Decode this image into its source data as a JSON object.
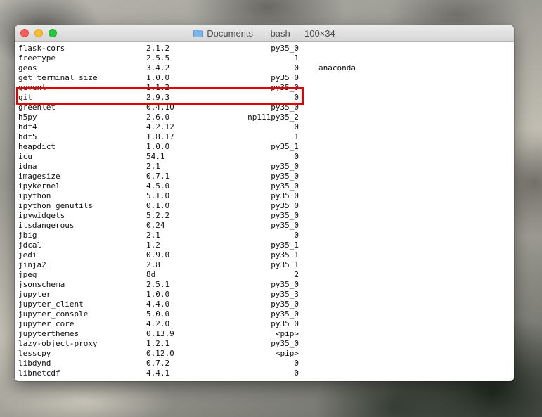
{
  "window": {
    "title": "Documents — -bash — 100×34",
    "folder_icon": "folder-icon",
    "colors": {
      "close": "#fc5f57",
      "minimize": "#fdbc2e",
      "maximize": "#28c840",
      "highlight": "#e50000"
    }
  },
  "terminal": {
    "rows": [
      {
        "name": "flask-cors",
        "version": "2.1.2",
        "build": "py35_0",
        "channel": ""
      },
      {
        "name": "freetype",
        "version": "2.5.5",
        "build": "1",
        "channel": ""
      },
      {
        "name": "geos",
        "version": "3.4.2",
        "build": "0",
        "channel": "anaconda"
      },
      {
        "name": "get_terminal_size",
        "version": "1.0.0",
        "build": "py35_0",
        "channel": ""
      },
      {
        "name": "gevent",
        "version": "1.1.2",
        "build": "py35_0",
        "channel": ""
      },
      {
        "name": "git",
        "version": "2.9.3",
        "build": "0",
        "channel": ""
      },
      {
        "name": "greenlet",
        "version": "0.4.10",
        "build": "py35_0",
        "channel": ""
      },
      {
        "name": "h5py",
        "version": "2.6.0",
        "build": "np111py35_2",
        "channel": ""
      },
      {
        "name": "hdf4",
        "version": "4.2.12",
        "build": "0",
        "channel": ""
      },
      {
        "name": "hdf5",
        "version": "1.8.17",
        "build": "1",
        "channel": ""
      },
      {
        "name": "heapdict",
        "version": "1.0.0",
        "build": "py35_1",
        "channel": ""
      },
      {
        "name": "icu",
        "version": "54.1",
        "build": "0",
        "channel": ""
      },
      {
        "name": "idna",
        "version": "2.1",
        "build": "py35_0",
        "channel": ""
      },
      {
        "name": "imagesize",
        "version": "0.7.1",
        "build": "py35_0",
        "channel": ""
      },
      {
        "name": "ipykernel",
        "version": "4.5.0",
        "build": "py35_0",
        "channel": ""
      },
      {
        "name": "ipython",
        "version": "5.1.0",
        "build": "py35_0",
        "channel": ""
      },
      {
        "name": "ipython_genutils",
        "version": "0.1.0",
        "build": "py35_0",
        "channel": ""
      },
      {
        "name": "ipywidgets",
        "version": "5.2.2",
        "build": "py35_0",
        "channel": ""
      },
      {
        "name": "itsdangerous",
        "version": "0.24",
        "build": "py35_0",
        "channel": ""
      },
      {
        "name": "jbig",
        "version": "2.1",
        "build": "0",
        "channel": ""
      },
      {
        "name": "jdcal",
        "version": "1.2",
        "build": "py35_1",
        "channel": ""
      },
      {
        "name": "jedi",
        "version": "0.9.0",
        "build": "py35_1",
        "channel": ""
      },
      {
        "name": "jinja2",
        "version": "2.8",
        "build": "py35_1",
        "channel": ""
      },
      {
        "name": "jpeg",
        "version": "8d",
        "build": "2",
        "channel": ""
      },
      {
        "name": "jsonschema",
        "version": "2.5.1",
        "build": "py35_0",
        "channel": ""
      },
      {
        "name": "jupyter",
        "version": "1.0.0",
        "build": "py35_3",
        "channel": ""
      },
      {
        "name": "jupyter_client",
        "version": "4.4.0",
        "build": "py35_0",
        "channel": ""
      },
      {
        "name": "jupyter_console",
        "version": "5.0.0",
        "build": "py35_0",
        "channel": ""
      },
      {
        "name": "jupyter_core",
        "version": "4.2.0",
        "build": "py35_0",
        "channel": ""
      },
      {
        "name": "jupyterthemes",
        "version": "0.13.9",
        "build": "<pip>",
        "channel": ""
      },
      {
        "name": "lazy-object-proxy",
        "version": "1.2.1",
        "build": "py35_0",
        "channel": ""
      },
      {
        "name": "lesscpy",
        "version": "0.12.0",
        "build": "<pip>",
        "channel": ""
      },
      {
        "name": "libdynd",
        "version": "0.7.2",
        "build": "0",
        "channel": ""
      },
      {
        "name": "libnetcdf",
        "version": "4.4.1",
        "build": "0",
        "channel": ""
      }
    ],
    "highlighted_package": "git"
  }
}
